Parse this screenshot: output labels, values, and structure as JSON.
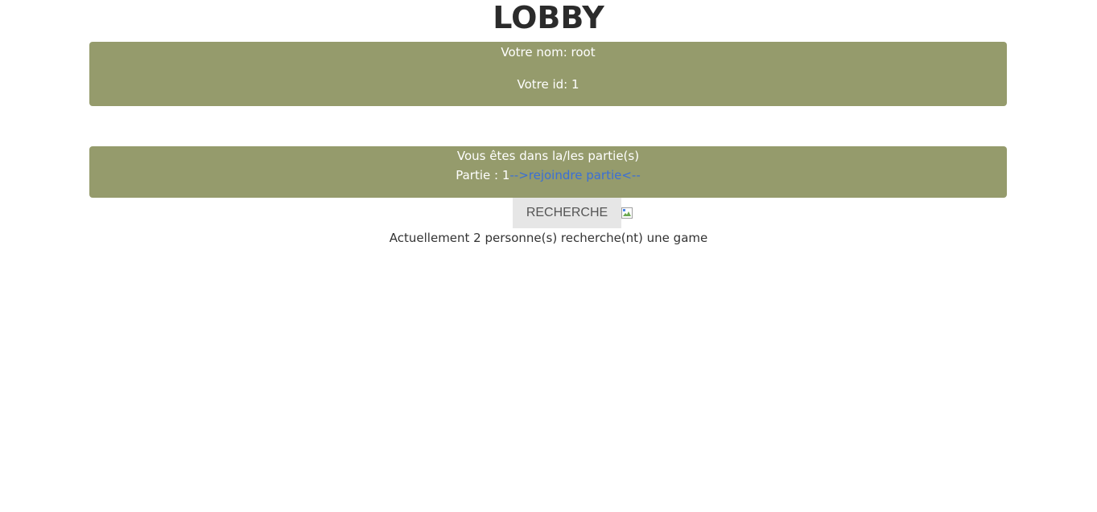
{
  "page": {
    "title": "LOBBY"
  },
  "user_panel": {
    "name_line": "Votre nom: root",
    "id_line": "Votre id: 1"
  },
  "games_panel": {
    "heading": "Vous êtes dans la/les partie(s)",
    "games": [
      {
        "label": "Partie : 1",
        "join_link": "-->rejoindre partie<--"
      }
    ]
  },
  "search": {
    "button_label": "RECHERCHE",
    "loading_image_icon": "broken-image-icon",
    "status_text": "Actuellement 2 personne(s) recherche(nt) une game"
  },
  "colors": {
    "panel_background": "#959b6c",
    "link": "#3a6fd6",
    "button_background": "#e6e6e6"
  }
}
